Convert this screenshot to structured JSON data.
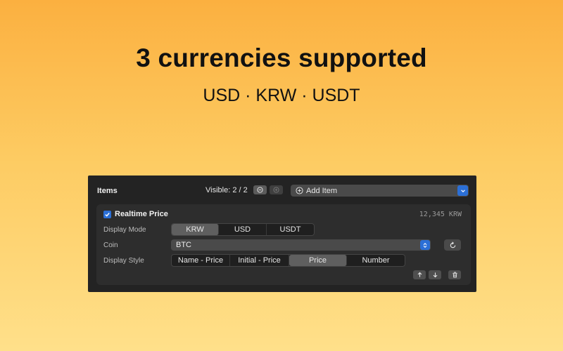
{
  "hero": {
    "title": "3 currencies supported",
    "subtitle": "USD · KRW · USDT"
  },
  "panel": {
    "items_label": "Items",
    "visible_label": "Visible: 2 / 2",
    "add_item_label": "Add Item",
    "item": {
      "enabled": true,
      "title": "Realtime Price",
      "price_readout": "12,345 KRW",
      "display_mode": {
        "label": "Display Mode",
        "options": [
          "KRW",
          "USD",
          "USDT"
        ],
        "selected": "KRW"
      },
      "coin": {
        "label": "Coin",
        "value": "BTC"
      },
      "display_style": {
        "label": "Display Style",
        "options": [
          "Name - Price",
          "Initial - Price",
          "Price",
          "Number"
        ],
        "selected": "Price"
      }
    }
  },
  "colors": {
    "accent": "#2b6fd6",
    "panel_bg": "#232323",
    "card_bg": "#2d2d2d",
    "background_top": "#fbb040",
    "background_bottom": "#ffe08a"
  },
  "icons": [
    "minus-circle-icon",
    "plus-circle-icon",
    "chevron-down-icon",
    "checkmark-icon",
    "updown-chevron-icon",
    "refresh-icon",
    "arrow-up-icon",
    "arrow-down-icon",
    "trash-icon"
  ]
}
